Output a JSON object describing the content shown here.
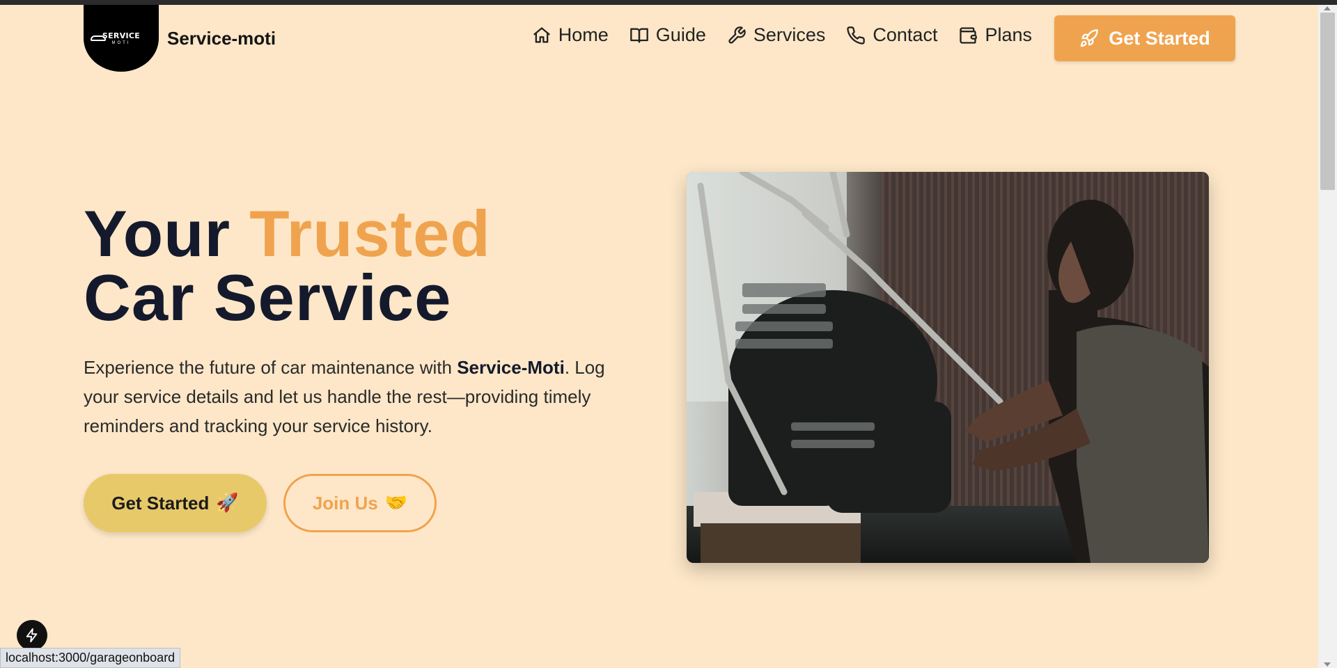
{
  "brand": {
    "logo_text_top": "SERVICE",
    "logo_text_bottom": "MOTI",
    "name": "Service-moti"
  },
  "nav": {
    "items": [
      {
        "label": "Home",
        "icon": "home-icon"
      },
      {
        "label": "Guide",
        "icon": "book-icon"
      },
      {
        "label": "Services",
        "icon": "wrench-icon"
      },
      {
        "label": "Contact",
        "icon": "phone-icon"
      },
      {
        "label": "Plans",
        "icon": "wallet-icon"
      }
    ],
    "cta_label": "Get Started",
    "cta_icon": "rocket-icon"
  },
  "hero": {
    "title_line1_prefix": "Your",
    "title_line1_accent": "Trusted",
    "title_line2": "Car Service",
    "desc_before": "Experience the future of car maintenance with",
    "desc_bold": "Service-Moti",
    "desc_after": ". Log your service details and let us handle the rest—providing timely reminders and tracking your service history.",
    "primary_button": "Get Started",
    "primary_button_emoji": "🚀",
    "secondary_button": "Join Us",
    "secondary_button_emoji": "🤝",
    "image": "mechanic-working-on-motorcycle-engine"
  },
  "status_bar": {
    "url": "localhost:3000/garageonboard"
  },
  "colors": {
    "background": "#fde7c8",
    "accent": "#f0a34e",
    "primary_button": "#e8c96a",
    "heading": "#141a2c"
  }
}
